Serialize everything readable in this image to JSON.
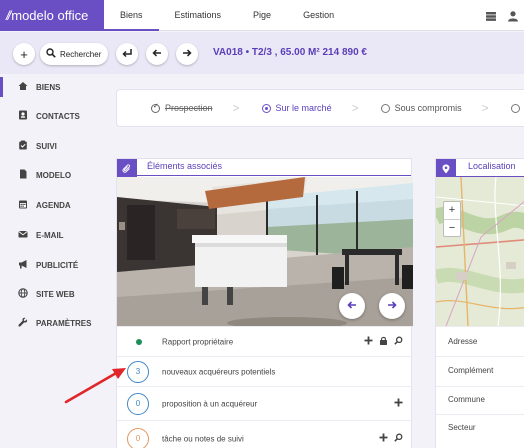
{
  "app": {
    "logo_mark": "//",
    "logo_text": "modelo office"
  },
  "top_tabs": [
    {
      "label": "Biens"
    },
    {
      "label": "Estimations"
    },
    {
      "label": "Pige"
    },
    {
      "label": "Gestion"
    }
  ],
  "header": {
    "add_icon": "+",
    "search_label": "Rechercher",
    "property_title": "VA018 • T2/3 , 65.00 M² 214 890 €"
  },
  "sidebar": {
    "items": [
      {
        "label": "BIENS",
        "icon": "house-icon"
      },
      {
        "label": "CONTACTS",
        "icon": "contacts-icon"
      },
      {
        "label": "SUIVI",
        "icon": "clipboard-icon"
      },
      {
        "label": "MODELO",
        "icon": "document-icon"
      },
      {
        "label": "AGENDA",
        "icon": "calendar-icon"
      },
      {
        "label": "E-MAIL",
        "icon": "envelope-icon"
      },
      {
        "label": "PUBLICITÉ",
        "icon": "megaphone-icon"
      },
      {
        "label": "SITE WEB",
        "icon": "globe-icon"
      },
      {
        "label": "PARAMÈTRES",
        "icon": "wrench-icon"
      }
    ]
  },
  "status_steps": [
    {
      "label": "Prospection",
      "state": "done"
    },
    {
      "label": "Sur le marché",
      "state": "current"
    },
    {
      "label": "Sous compromis",
      "state": "todo"
    }
  ],
  "associated": {
    "title": "Éléments associés",
    "rows": [
      {
        "label": "Rapport propriétaire"
      },
      {
        "count": "3",
        "label": "nouveaux acquéreurs potentiels"
      },
      {
        "count": "0",
        "label": "proposition à un acquéreur"
      },
      {
        "count": "0",
        "label": "tâche ou notes de suivi"
      }
    ]
  },
  "localisation": {
    "title": "Localisation",
    "zoom_in": "+",
    "zoom_out": "−",
    "fields": [
      {
        "label": "Adresse"
      },
      {
        "label": "Complément"
      },
      {
        "label": "Commune"
      },
      {
        "label": "Secteur"
      }
    ]
  },
  "colors": {
    "brand": "#6a4fc4",
    "count_blue": "#3f87c6",
    "count_orange": "#e09660",
    "status_green": "#1c8f5a",
    "annotation_red": "#e0262a"
  }
}
